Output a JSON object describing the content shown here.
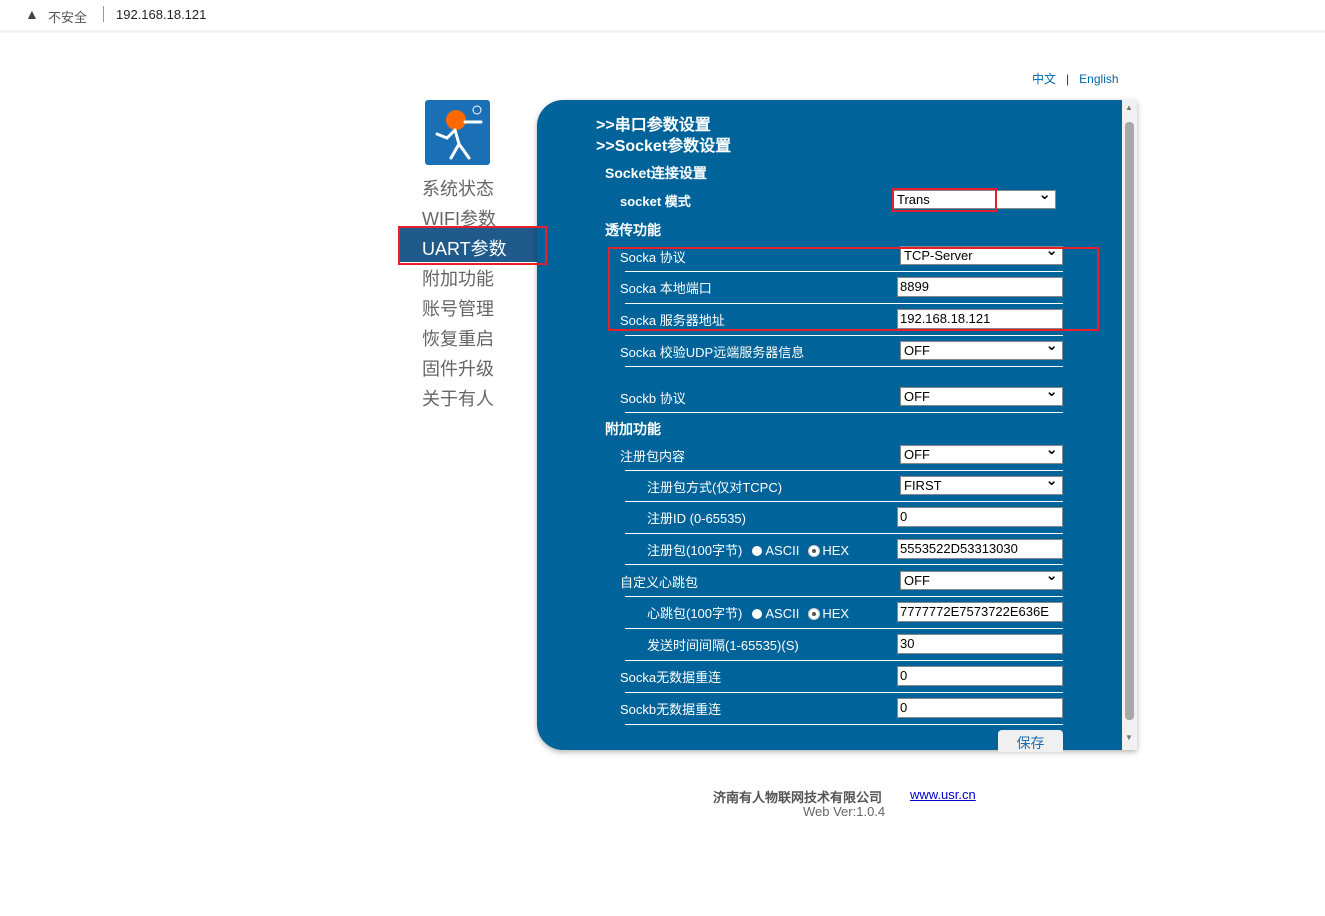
{
  "browser": {
    "security_label": "不安全",
    "url": "192.168.18.121"
  },
  "lang": {
    "zh": "中文",
    "sep": "|",
    "en": "English"
  },
  "nav": [
    "系统状态",
    "WIFI参数",
    "UART参数",
    "附加功能",
    "账号管理",
    "恢复重启",
    "固件升级",
    "关于有人"
  ],
  "nav_active": 2,
  "panel": {
    "headers": [
      ">>串口参数设置",
      ">>Socket参数设置"
    ],
    "rows": [
      {
        "kind": "section",
        "label": "Socket连接设置"
      },
      {
        "kind": "row",
        "label": "socket 模式",
        "bold": true,
        "control": "select",
        "value": "Trans"
      },
      {
        "kind": "section",
        "label": "透传功能"
      },
      {
        "kind": "row",
        "label": "Socka 协议",
        "control": "select",
        "value": "TCP-Server"
      },
      {
        "kind": "row",
        "label": "Socka 本地端口",
        "control": "input",
        "value": "8899"
      },
      {
        "kind": "row",
        "label": "Socka 服务器地址",
        "control": "input",
        "value": "192.168.18.121"
      },
      {
        "kind": "row",
        "label": "Socka 校验UDP远端服务器信息",
        "control": "select",
        "value": "OFF"
      },
      {
        "kind": "row",
        "label": "Sockb 协议",
        "control": "select",
        "value": "OFF"
      },
      {
        "kind": "section",
        "label": "附加功能"
      },
      {
        "kind": "row",
        "label": "注册包内容",
        "control": "select",
        "value": "OFF"
      },
      {
        "kind": "row",
        "label": "注册包方式(仅对TCPC)",
        "indent": true,
        "control": "select",
        "value": "FIRST"
      },
      {
        "kind": "row",
        "label": "注册ID (0-65535)",
        "indent": true,
        "control": "input",
        "value": "0"
      },
      {
        "kind": "row",
        "label": "注册包(100字节)",
        "indent": true,
        "radio": [
          "ASCII",
          "HEX"
        ],
        "radio_selected": "HEX",
        "control": "input",
        "value": "5553522D53313030"
      },
      {
        "kind": "row",
        "label": "自定义心跳包",
        "control": "select",
        "value": "OFF"
      },
      {
        "kind": "row",
        "label": "心跳包(100字节)",
        "indent": true,
        "radio": [
          "ASCII",
          "HEX"
        ],
        "radio_selected": "HEX",
        "control": "input",
        "value": "7777772E7573722E636E"
      },
      {
        "kind": "row",
        "label": "发送时间间隔(1-65535)(S)",
        "indent": true,
        "control": "input",
        "value": "30"
      },
      {
        "kind": "row",
        "label": "Socka无数据重连",
        "control": "input",
        "value": "0"
      },
      {
        "kind": "row",
        "label": "Sockb无数据重连",
        "control": "input",
        "value": "0"
      }
    ],
    "save_label": "保存"
  },
  "footer": {
    "company": "济南有人物联网技术有限公司",
    "link": "www.usr.cn",
    "version": "Web Ver:1.0.4"
  },
  "colors": {
    "panel": "#00649a",
    "highlight": "#e5202a",
    "logo_orange": "#ff6a00"
  }
}
